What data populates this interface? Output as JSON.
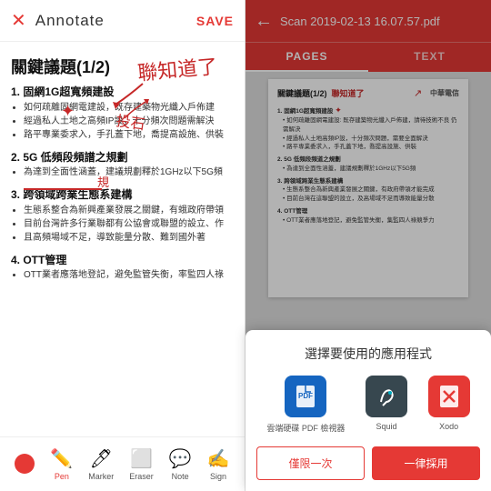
{
  "left": {
    "header": {
      "close_label": "✕",
      "title": "Annotate",
      "save_label": "SAVE"
    },
    "doc_title": "關鍵議題(1/2)",
    "sections": [
      {
        "number": "1.",
        "heading": "固網1G超寬頻建設",
        "bullets": [
          "如何疏離固網電建設，既存建築物光纖入戶佈建",
          "經過私人土地之高頻IP設，十分頻次問題需解決",
          "路平專業委求入，手孔蓋下地，喬提高設施、供裝"
        ]
      },
      {
        "number": "2.",
        "heading": "5G 低頻段頻譜之規劃",
        "bullets": [
          "為達到全面性涵蓋，建議規劃釋於1GHz以下5G頻"
        ]
      },
      {
        "number": "3.",
        "heading": "跨領域跨業生態系建構",
        "bullets": [
          "生態系整合為新興產業發展之關鍵，有蛾政府帶領",
          "目前台灣許多行業聯都有公協會或聯盟的設立、作",
          "且高頻場域不足，導致能量分散、難到國外著"
        ]
      },
      {
        "number": "4.",
        "heading": "OTT管理",
        "bullets": [
          "OTT業者應落地登記，避免監管失衡，率監四人祿"
        ]
      }
    ],
    "toolbar": {
      "pen_label": "Pen",
      "marker_label": "Marker",
      "eraser_label": "Eraser",
      "note_label": "Note",
      "sign_label": "Sign"
    }
  },
  "right": {
    "header": {
      "back_icon": "←",
      "file_title": "Scan 2019-02-13 16.07.57.pdf"
    },
    "tabs": [
      {
        "label": "PAGES",
        "active": true
      },
      {
        "label": "TEXT",
        "active": false
      }
    ],
    "preview": {
      "title": "關鍵議題(1/2)  聯知道了",
      "sections": [
        "1. 固網1G超寬頻建設",
        "  • 如何疏離固網電建設: 既存建築物光纖入戶佈建",
        "  • 經過私人土地高頻IP設，十分頻次問題",
        "  • 路平専業委求入，手孔蓋下地，喬提高設施、供裝",
        "2. 5G 低頻段頻道之規劃",
        "  • 為達到全面性涵蓋，建議規劃釋於1GHz以下5G頻",
        "3. 跨領域跨業生態系建構",
        "  • 生態系整合為新興產業發展之關鍵...",
        "4. OTT管理",
        "  • OTT業者應落地登記，避免監管失衡..."
      ]
    }
  },
  "dialog": {
    "title": "選擇要使用的應用程式",
    "apps": [
      {
        "name": "雲端硬碟 PDF 檢視器",
        "icon": "📄",
        "color": "#1565c0"
      },
      {
        "name": "Squid",
        "icon": "✒",
        "color": "#37474f"
      },
      {
        "name": "Xodo",
        "icon": "✖",
        "color": "#e53935"
      }
    ],
    "btn_once": "僅限一次",
    "btn_always": "一律採用"
  }
}
